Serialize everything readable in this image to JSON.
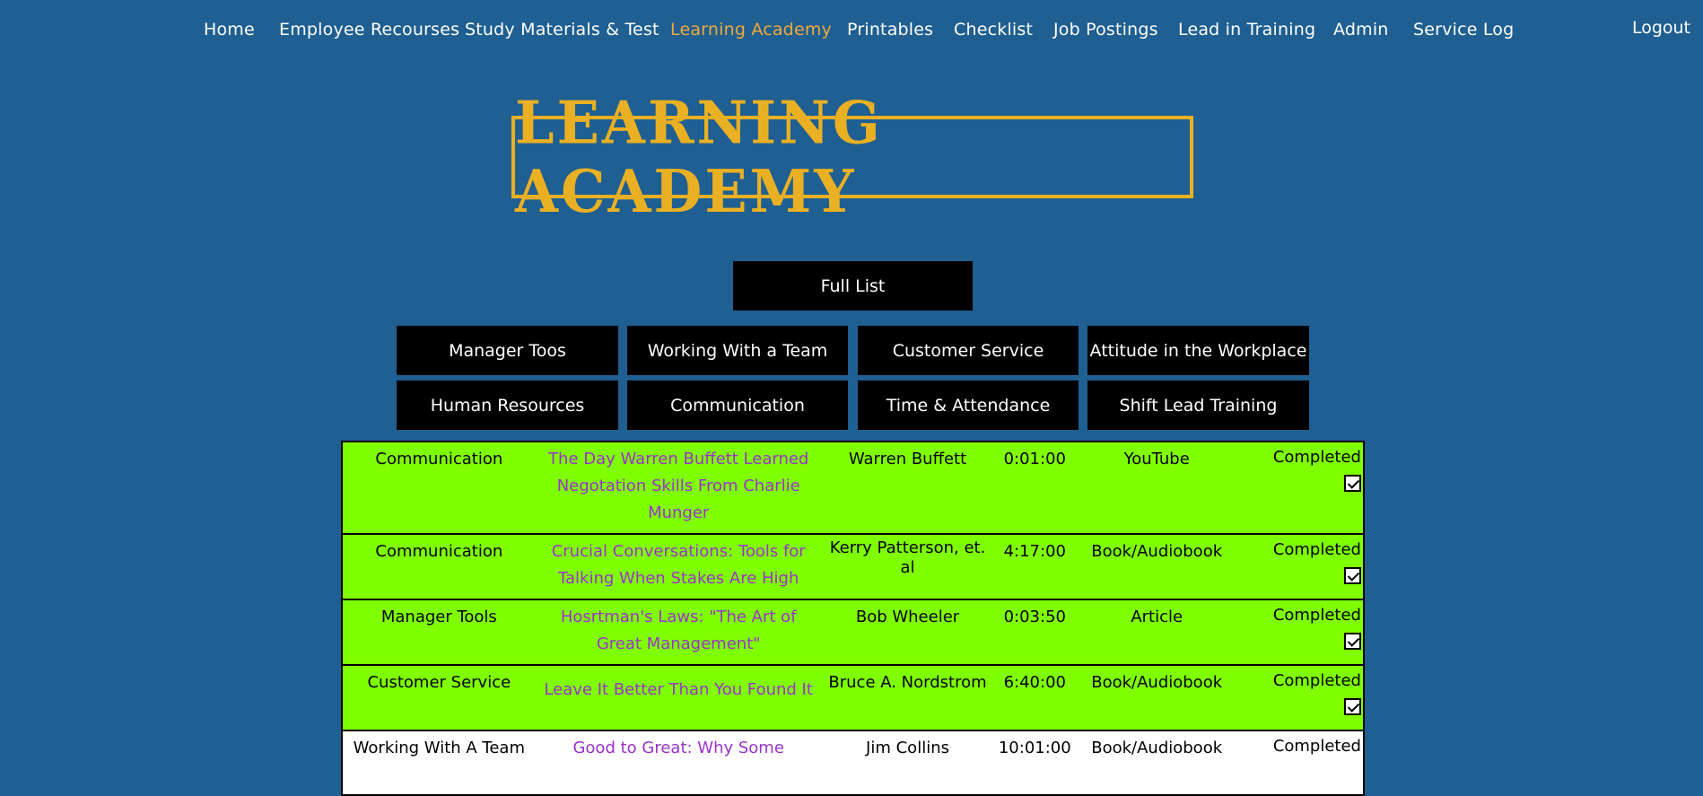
{
  "nav": {
    "items": [
      {
        "label": "Home"
      },
      {
        "label": "Employee Recourses"
      },
      {
        "label": "Study Materials & Test"
      },
      {
        "label": "Learning Academy"
      },
      {
        "label": "Printables"
      },
      {
        "label": "Checklist"
      },
      {
        "label": "Job Postings"
      },
      {
        "label": "Lead in Training"
      },
      {
        "label": "Admin"
      },
      {
        "label": "Service Log"
      }
    ],
    "active": "Learning Academy",
    "logout": "Logout"
  },
  "hero": {
    "title": "LEARNING ACADEMY"
  },
  "filters": {
    "full_list": "Full List",
    "categories": [
      "Manager Toos",
      "Working With a Team",
      "Customer Service",
      "Attitude in the Workplace",
      "Human Resources",
      "Communication",
      "Time & Attendance",
      "Shift Lead Training"
    ]
  },
  "rows": [
    {
      "category": "Communication",
      "title": "The Day Warren Buffett Learned Negotation Skills From Charlie Munger",
      "author": "Warren Buffett",
      "duration": "0:01:00",
      "format": "YouTube",
      "status": "Completed",
      "checked": true
    },
    {
      "category": "Communication",
      "title": "Crucial Conversations: Tools for Talking When Stakes Are High",
      "author": "Kerry Patterson, et. al",
      "duration": "4:17:00",
      "format": "Book/Audiobook",
      "status": "Completed",
      "checked": true
    },
    {
      "category": "Manager Tools",
      "title": "Hosrtman's Laws: \"The Art of Great Management\"",
      "author": "Bob Wheeler",
      "duration": "0:03:50",
      "format": "Article",
      "status": "Completed",
      "checked": true
    },
    {
      "category": "Customer Service",
      "title": "Leave It Better Than You Found It",
      "author": "Bruce A. Nordstrom",
      "duration": "6:40:00",
      "format": "Book/Audiobook",
      "status": "Completed",
      "checked": true
    },
    {
      "category": "Working With A Team",
      "title": "Good to Great: Why Some",
      "author": "Jim Collins",
      "duration": "10:01:00",
      "format": "Book/Audiobook",
      "status": "Completed",
      "checked": false
    }
  ],
  "colors": {
    "background": "#1f5f91",
    "accent": "#eab023",
    "active_nav": "#f0a93a",
    "completed_row": "#7fff00",
    "link": "#9a33cc"
  }
}
